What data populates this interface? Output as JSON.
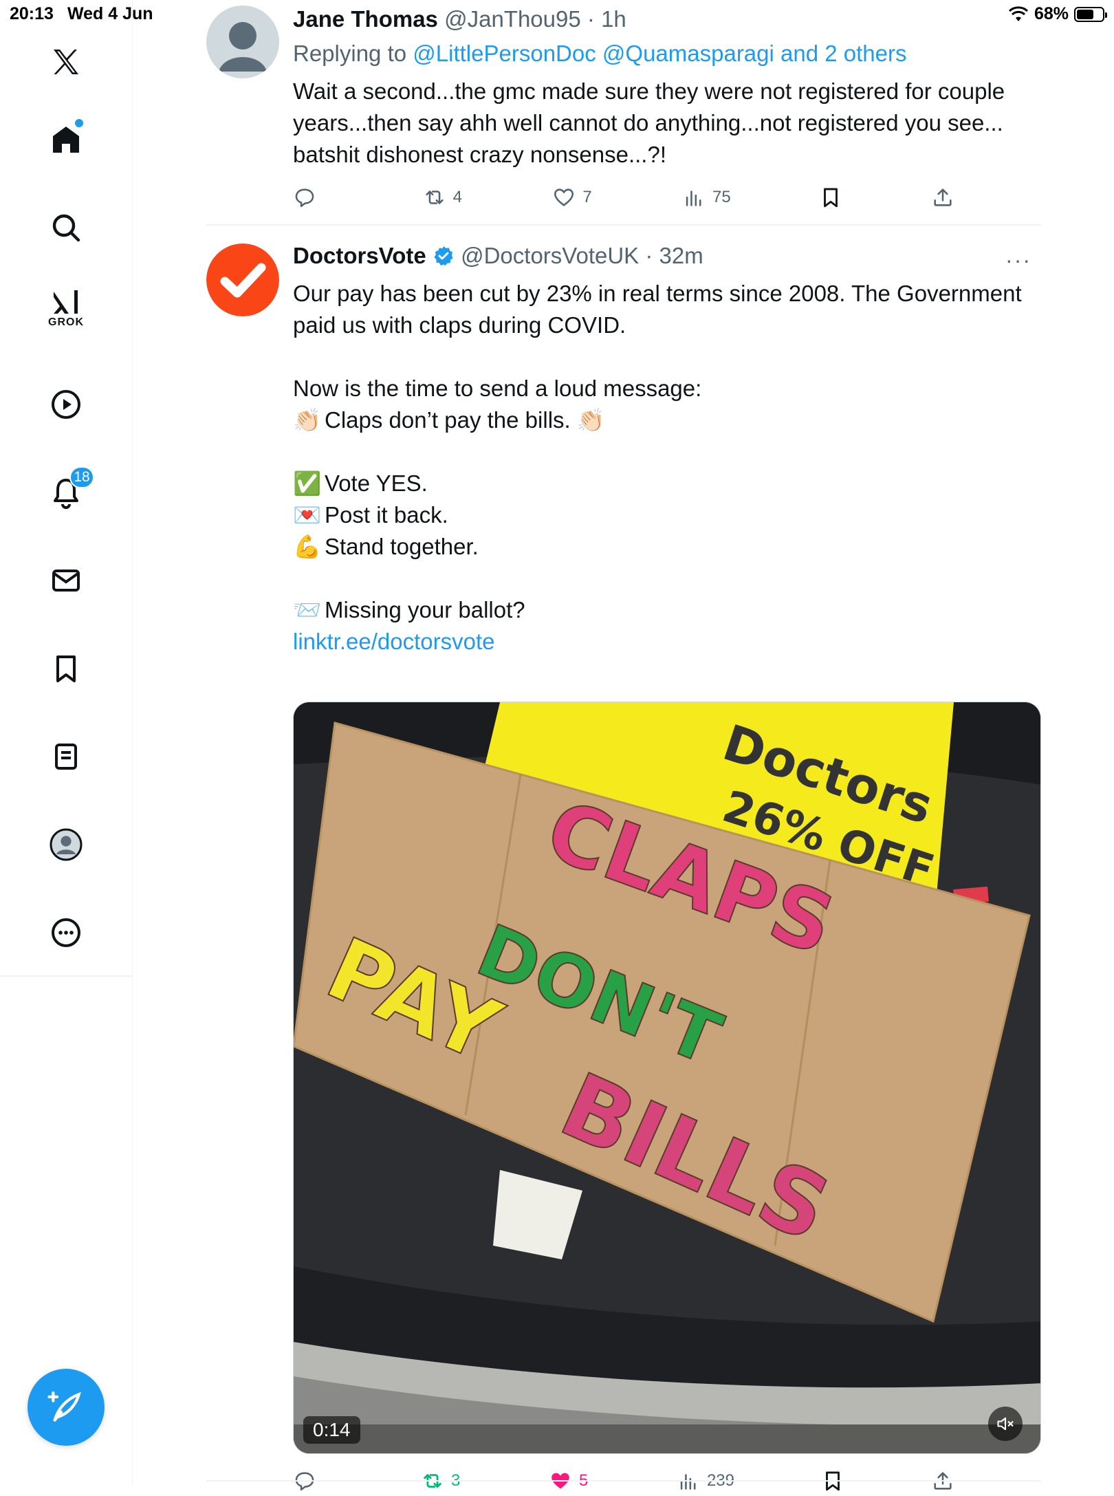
{
  "status_bar": {
    "time": "20:13",
    "date": "Wed 4 Jun",
    "battery": "68%",
    "battery_level": 0.68
  },
  "sidebar": {
    "items": [
      {
        "name": "x-logo",
        "icon": "x-logo-icon"
      },
      {
        "name": "home",
        "icon": "home-icon"
      },
      {
        "name": "search",
        "icon": "search-icon"
      },
      {
        "name": "grok",
        "icon": "grok-icon",
        "label": "GROK"
      },
      {
        "name": "video",
        "icon": "play-icon"
      },
      {
        "name": "notifications",
        "icon": "bell-icon",
        "badge": "18"
      },
      {
        "name": "messages",
        "icon": "mail-icon"
      },
      {
        "name": "bookmarks",
        "icon": "bookmark-icon"
      },
      {
        "name": "lists",
        "icon": "list-icon"
      },
      {
        "name": "profile",
        "icon": "avatar-icon"
      },
      {
        "name": "more",
        "icon": "more-circle-icon"
      }
    ],
    "compose_icon": "compose-icon"
  },
  "tweets": [
    {
      "name": "Jane Thomas",
      "handle": "@JanThou95",
      "time": "1h",
      "replying_prefix": "Replying to",
      "replying_to": "@LittlePersonDoc @Quamasparagi and 2 others",
      "text": "Wait a second...the gmc made sure they were not registered for couple years...then say ahh well cannot do anything...not registered you see... batshit dishonest crazy nonsense...?!",
      "retweets": "4",
      "likes": "7",
      "views": "75"
    },
    {
      "name": "DoctorsVote",
      "handle": "@DoctorsVoteUK",
      "time": "32m",
      "verified": true,
      "lines": [
        "Our pay has been cut by 23% in real terms since 2008. The Government paid us with claps during COVID.",
        "Now is the time to send a loud message:",
        "Claps don’t pay the bills.",
        "Vote YES.",
        "Post it back.",
        "Stand together.",
        "Missing your ballot?",
        "linktr.ee/doctorsvote"
      ],
      "emojis": {
        "clap": "👏🏻",
        "check": "✅",
        "letter": "💌",
        "muscle": "💪",
        "envelope": "📨"
      },
      "media": {
        "duration": "0:14",
        "sign_yellow_lines": [
          "Doctors",
          "26% OFF"
        ],
        "sign_cardboard_words": [
          "CLAPS",
          "DON'T",
          "PAY",
          "BILLS"
        ]
      },
      "retweets": "3",
      "likes": "5",
      "views": "239",
      "accent_like": "#f91880",
      "accent_retweet": "#00ba7c"
    }
  ],
  "colors": {
    "accent": "#1d9bf0",
    "text": "#0f1419",
    "secondary": "#536471"
  }
}
